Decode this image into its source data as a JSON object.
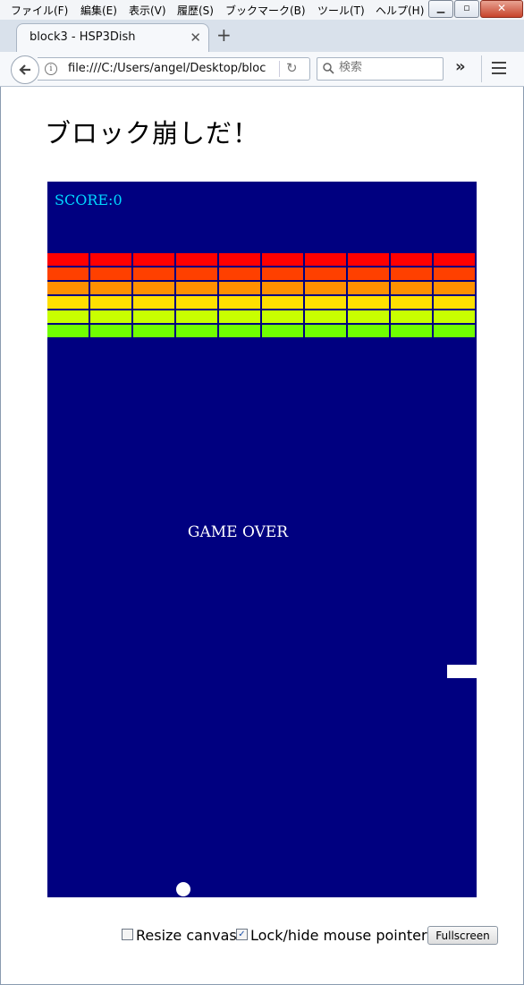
{
  "menubar": {
    "items": [
      "ファイル(F)",
      "編集(E)",
      "表示(V)",
      "履歴(S)",
      "ブックマーク(B)",
      "ツール(T)",
      "ヘルプ(H)"
    ],
    "window_buttons": [
      "minimize-icon",
      "restore-icon",
      "close-icon"
    ]
  },
  "tab": {
    "title": "block3 - HSP3Dish",
    "close_icon": "close-icon",
    "new_tab_icon": "plus-icon"
  },
  "navbar": {
    "url": "file:///C:/Users/angel/Desktop/bloc",
    "search_placeholder": "検索",
    "icons": [
      "back-arrow-icon",
      "info-icon",
      "reload-icon",
      "search-icon",
      "overflow-chevron-icon",
      "hamburger-menu-icon"
    ]
  },
  "page": {
    "title": "ブロック崩しだ！"
  },
  "game": {
    "score_text": "SCORE:0",
    "status_text": "GAME OVER",
    "brick_rows": 6,
    "brick_cols": 10,
    "brick_colors": [
      "#ff0000",
      "#ff4000",
      "#ff9000",
      "#ffe000",
      "#c8ff00",
      "#70ff00"
    ],
    "background": "#000080",
    "score_color": "#00d8ff"
  },
  "controls": {
    "resize_label": "Resize canvas",
    "resize_checked": false,
    "lock_label": "Lock/hide mouse pointer",
    "lock_checked": true,
    "fullscreen_label": "Fullscreen"
  }
}
